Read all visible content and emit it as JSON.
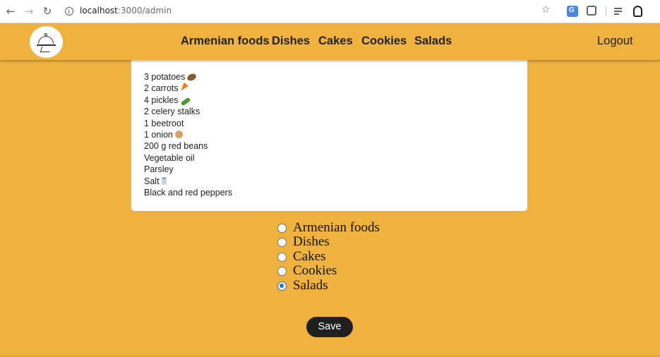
{
  "browser": {
    "url_host": "localhost",
    "url_path": ":3000/admin",
    "icons": [
      "back-icon",
      "forward-icon",
      "reload-icon",
      "info-icon",
      "star-icon",
      "translate-icon",
      "extensions-icon",
      "media-icon",
      "profile-icon"
    ]
  },
  "header": {
    "menu": [
      "Armenian foods",
      "Dishes",
      "Cakes",
      "Cookies",
      "Salads"
    ],
    "logout": "Logout",
    "colors": {
      "background": "#EFB23F",
      "text": "#222222"
    }
  },
  "recipe": {
    "ingredients": [
      {
        "text": "3 potatoes",
        "icon": "potato-emoji"
      },
      {
        "text": "2 carrots",
        "icon": "carrot-emoji"
      },
      {
        "text": "4 pickles",
        "icon": "cucumber-emoji"
      },
      {
        "text": "2 celery stalks"
      },
      {
        "text": "1 beetroot"
      },
      {
        "text": "1 onion",
        "icon": "onion-emoji"
      },
      {
        "text": "200 g red beans"
      },
      {
        "text": "Vegetable oil"
      },
      {
        "text": "Parsley"
      },
      {
        "text": "Salt",
        "icon": "salt-emoji"
      },
      {
        "text": "Black and red peppers"
      }
    ]
  },
  "category": {
    "options": [
      "Armenian foods",
      "Dishes",
      "Cakes",
      "Cookies",
      "Salads"
    ],
    "selected": "Salads"
  },
  "save_label": "Save"
}
